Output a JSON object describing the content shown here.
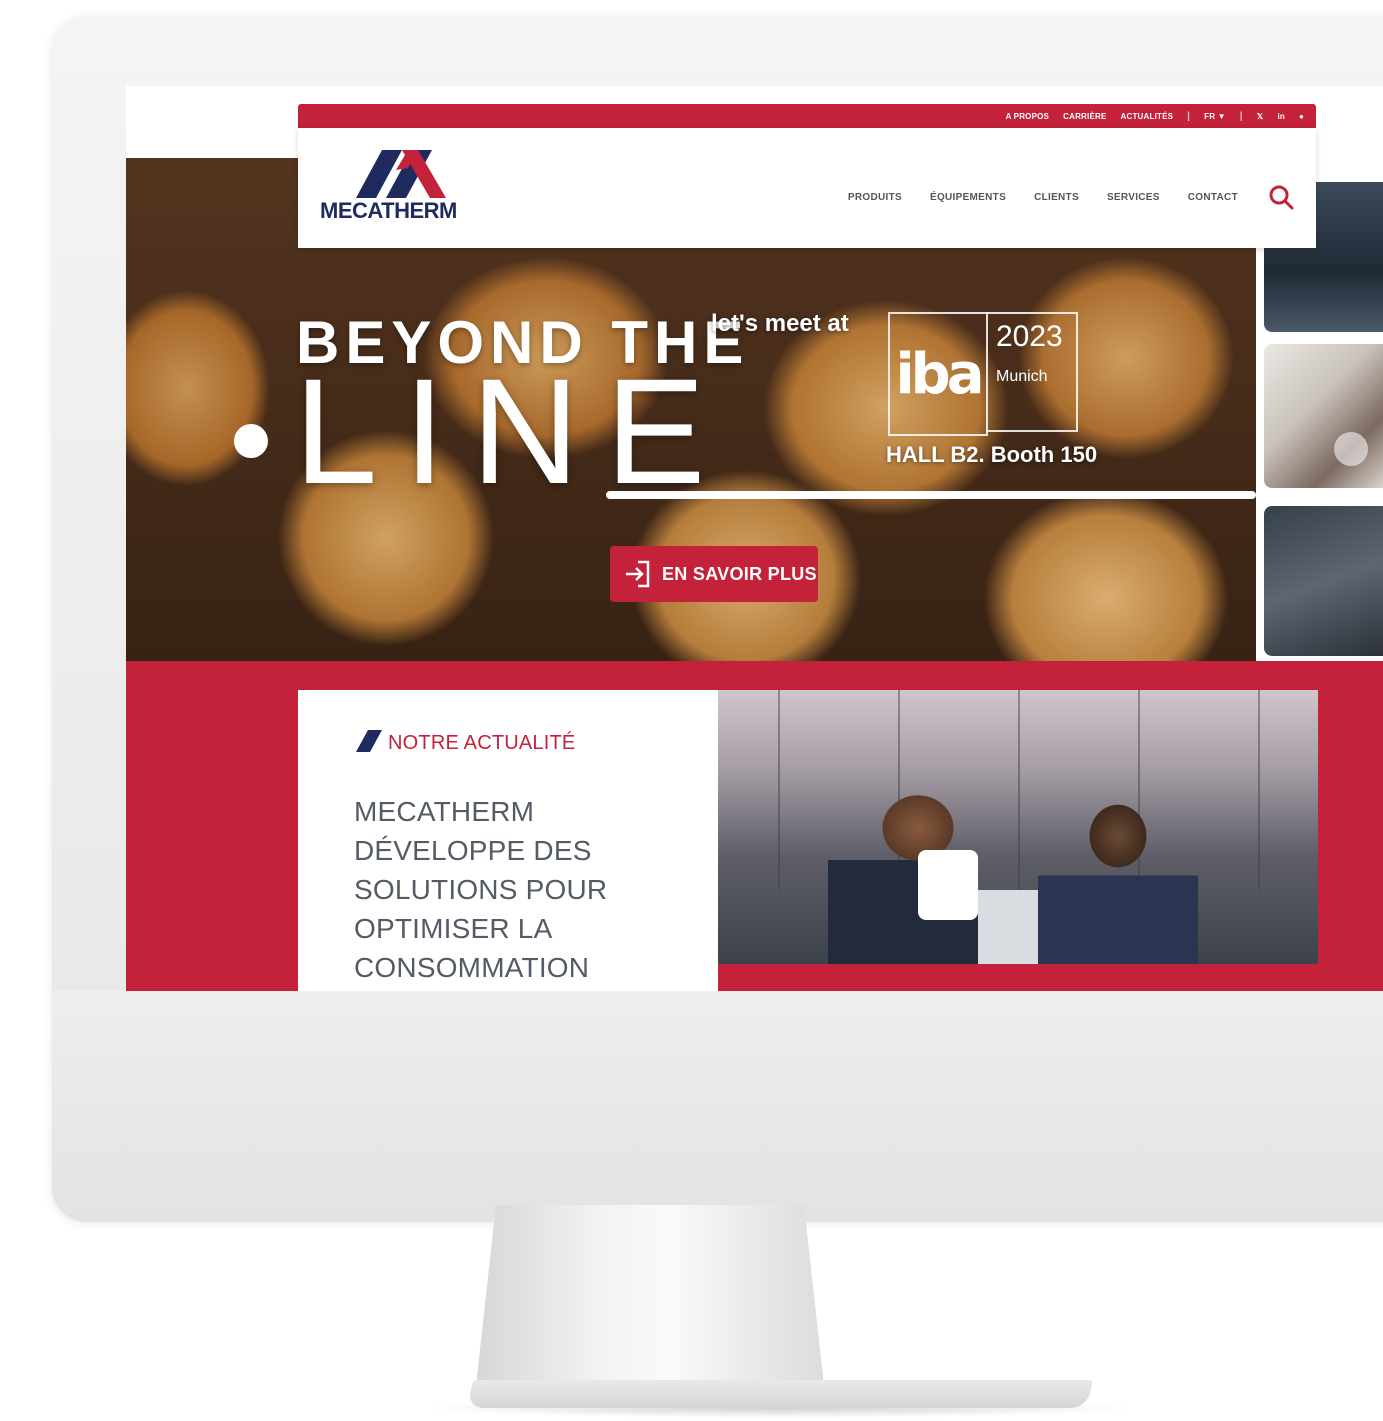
{
  "topbar": {
    "links": [
      "A PROPOS",
      "CARRIÈRE",
      "ACTUALITÉS"
    ],
    "lang": "FR ▼",
    "social": [
      "twitter-icon",
      "linkedin-icon",
      "youtube-icon"
    ]
  },
  "header": {
    "logo_text": "MECATHERM",
    "nav": [
      "PRODUITS",
      "ÉQUIPEMENTS",
      "CLIENTS",
      "SERVICES",
      "CONTACT"
    ]
  },
  "hero": {
    "line1": "BEYOND THE",
    "line2": "LINE",
    "meet": "let's meet at",
    "iba_logo": "iba",
    "iba_year": "2023",
    "iba_city": "Munich",
    "hall": "HALL B2. Booth 150",
    "cta": "EN SAVOIR PLUS"
  },
  "news": {
    "kicker": "NOTRE ACTUALITÉ",
    "title": "MECATHERM DÉVELOPPE DES SOLUTIONS POUR OPTIMISER LA CONSOMMATION ÉNERGÉTIQUE DES FOURS"
  },
  "colors": {
    "brand_red": "#c4213a",
    "brand_navy": "#1f2b5e"
  }
}
